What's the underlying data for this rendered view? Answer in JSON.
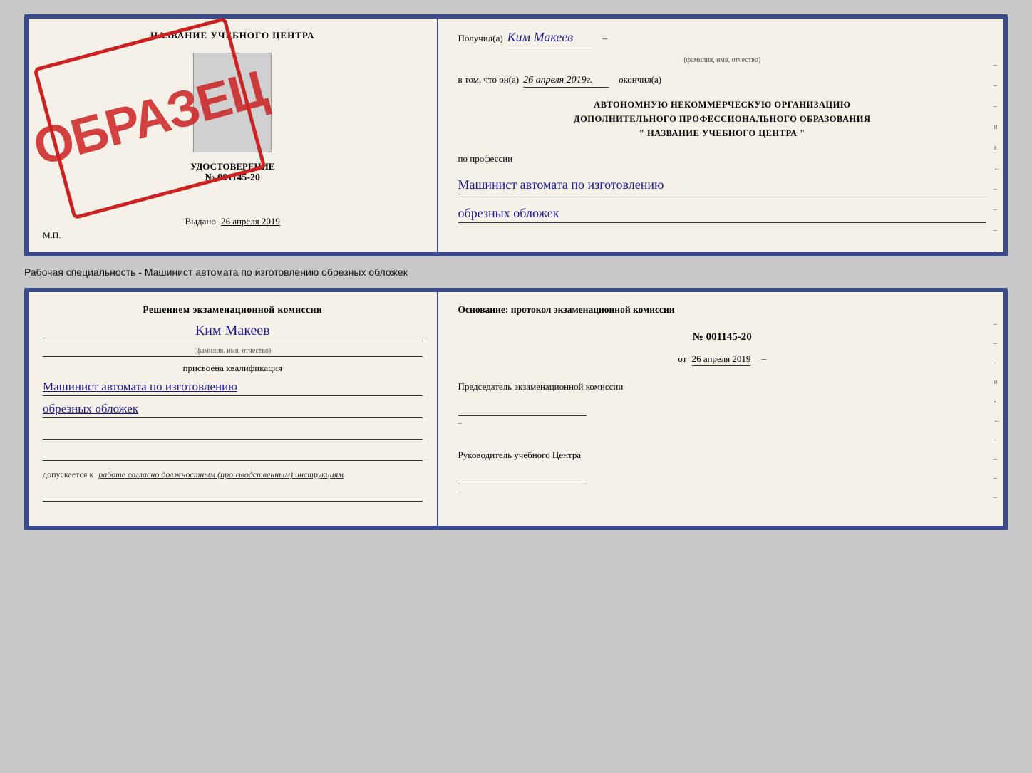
{
  "page": {
    "background": "#c8c8c8"
  },
  "top_cert": {
    "left": {
      "title": "НАЗВАНИЕ УЧЕБНОГО ЦЕНТРА",
      "doc_type": "УДОСТОВЕРЕНИЕ",
      "doc_number": "№ 001145-20",
      "issued_label": "Выдано",
      "issued_date": "26 апреля 2019",
      "mp_label": "М.П.",
      "stamp_text": "ОБРАЗЕЦ"
    },
    "right": {
      "received_label": "Получил(а)",
      "received_name": "Ким Макеев",
      "name_sub": "(фамилия, имя, отчество)",
      "in_that_label": "в том, что он(а)",
      "completion_date": "26 апреля 2019г.",
      "finished_label": "окончил(а)",
      "org_line1": "АВТОНОМНУЮ НЕКОММЕРЧЕСКУЮ ОРГАНИЗАЦИЮ",
      "org_line2": "ДОПОЛНИТЕЛЬНОГО ПРОФЕССИОНАЛЬНОГО ОБРАЗОВАНИЯ",
      "org_line3": "\"  НАЗВАНИЕ УЧЕБНОГО ЦЕНТРА  \"",
      "profession_label": "по профессии",
      "profession_line1": "Машинист автомата по изготовлению",
      "profession_line2": "обрезных обложек",
      "side_marks": [
        "-",
        "-",
        "-",
        "и",
        "а",
        "←",
        "-",
        "-",
        "-",
        "-"
      ]
    }
  },
  "caption": {
    "text": "Рабочая специальность - Машинист автомата по изготовлению обрезных обложек"
  },
  "bottom_cert": {
    "left": {
      "decision_title": "Решением экзаменационной комиссии",
      "name": "Ким Макеев",
      "name_sub": "(фамилия, имя, отчество)",
      "assigned_label": "присвоена квалификация",
      "qual_line1": "Машинист автомата по изготовлению",
      "qual_line2": "обрезных обложек",
      "allowed_label": "допускается к",
      "allowed_value": "работе согласно должностным (производственным) инструкциям"
    },
    "right": {
      "basis_label": "Основание: протокол экзаменационной комиссии",
      "protocol_number": "№ 001145-20",
      "date_prefix": "от",
      "date_value": "26 апреля 2019",
      "chairman_title": "Председатель экзаменационной комиссии",
      "head_title": "Руководитель учебного Центра",
      "side_marks": [
        "-",
        "-",
        "-",
        "и",
        "а",
        "←",
        "-",
        "-",
        "-",
        "-"
      ]
    }
  }
}
